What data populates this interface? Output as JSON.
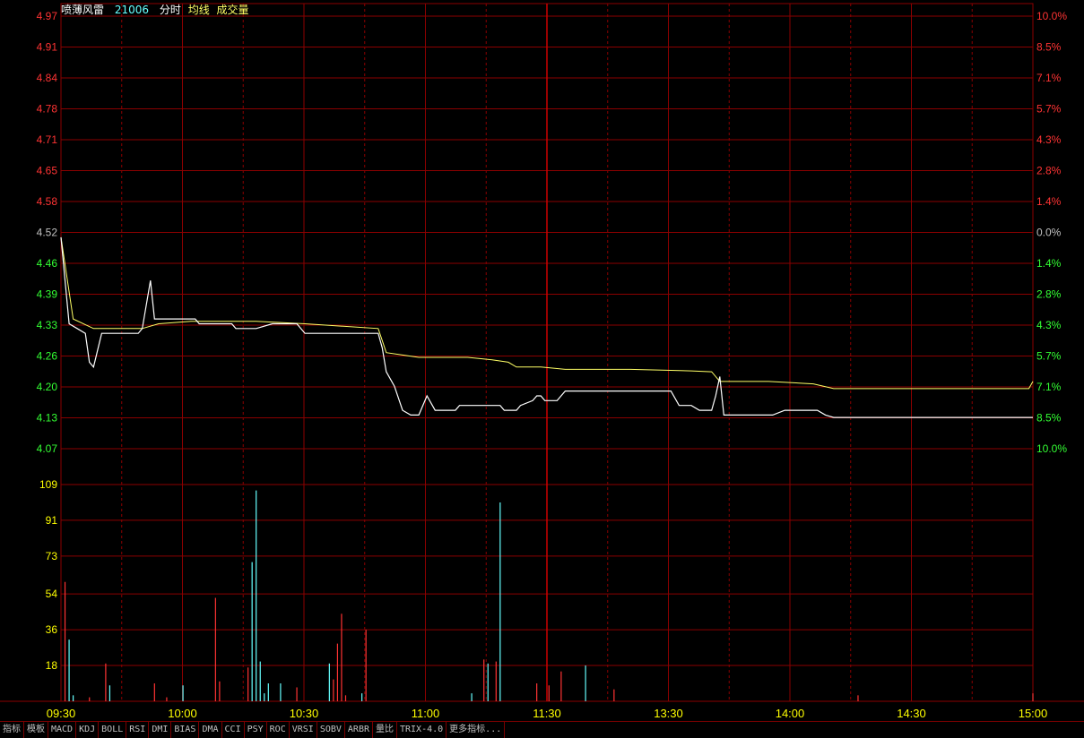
{
  "header": {
    "stock_name": "喷薄风雷",
    "stock_code": "21006",
    "label_intraday": "分时",
    "label_avg": "均线",
    "label_volume": "成交量"
  },
  "colors": {
    "background": "#000000",
    "grid": "#8b0000",
    "up": "#ff3333",
    "down": "#33ff33",
    "price_line": "#ffffff",
    "avg_line": "#ffff66",
    "volume_up": "#ff3333",
    "volume_down": "#66ffff",
    "volume_axis": "#ffff00",
    "time_axis": "#ffff00"
  },
  "chart_data": {
    "type": "line",
    "prev_close": 4.52,
    "price_ticks": [
      "4.97",
      "4.91",
      "4.84",
      "4.78",
      "4.71",
      "4.65",
      "4.58",
      "4.52",
      "4.46",
      "4.39",
      "4.33",
      "4.26",
      "4.20",
      "4.13",
      "4.07"
    ],
    "pct_ticks": [
      "10.0%",
      "8.5%",
      "7.1%",
      "5.7%",
      "4.3%",
      "2.8%",
      "1.4%",
      "0.0%",
      "1.4%",
      "2.8%",
      "4.3%",
      "5.7%",
      "7.1%",
      "8.5%",
      "10.0%"
    ],
    "ylim": [
      4.07,
      4.97
    ],
    "volume_ticks": [
      "109",
      "91",
      "73",
      "54",
      "36",
      "18"
    ],
    "volume_ylim": [
      0,
      127
    ],
    "time_labels": [
      "09:30",
      "10:00",
      "10:30",
      "11:00",
      "11:30",
      "13:30",
      "14:00",
      "14:30",
      "15:00"
    ],
    "price_series": [
      [
        0,
        4.51
      ],
      [
        2,
        4.33
      ],
      [
        4,
        4.32
      ],
      [
        6,
        4.31
      ],
      [
        7,
        4.25
      ],
      [
        8,
        4.24
      ],
      [
        10,
        4.31
      ],
      [
        14,
        4.31
      ],
      [
        19,
        4.31
      ],
      [
        20,
        4.32
      ],
      [
        22,
        4.42
      ],
      [
        23,
        4.34
      ],
      [
        33,
        4.34
      ],
      [
        34,
        4.33
      ],
      [
        42,
        4.33
      ],
      [
        43,
        4.32
      ],
      [
        48,
        4.32
      ],
      [
        52,
        4.33
      ],
      [
        58,
        4.33
      ],
      [
        60,
        4.31
      ],
      [
        64,
        4.31
      ],
      [
        70,
        4.31
      ],
      [
        72,
        4.31
      ],
      [
        78,
        4.31
      ],
      [
        79,
        4.28
      ],
      [
        80,
        4.23
      ],
      [
        82,
        4.2
      ],
      [
        84,
        4.15
      ],
      [
        86,
        4.14
      ],
      [
        88,
        4.14
      ],
      [
        90,
        4.18
      ],
      [
        92,
        4.15
      ],
      [
        97,
        4.15
      ],
      [
        98,
        4.16
      ],
      [
        108,
        4.16
      ],
      [
        109,
        4.15
      ],
      [
        112,
        4.15
      ],
      [
        113,
        4.16
      ],
      [
        116,
        4.17
      ],
      [
        117,
        4.18
      ],
      [
        118,
        4.18
      ],
      [
        119,
        4.17
      ],
      [
        122,
        4.17
      ],
      [
        124,
        4.19
      ],
      [
        150,
        4.19
      ],
      [
        152,
        4.16
      ],
      [
        155,
        4.16
      ],
      [
        157,
        4.15
      ],
      [
        160,
        4.15
      ],
      [
        161,
        4.18
      ],
      [
        162,
        4.22
      ],
      [
        163,
        4.14
      ],
      [
        168,
        4.14
      ],
      [
        175,
        4.14
      ],
      [
        178,
        4.15
      ],
      [
        186,
        4.15
      ],
      [
        188,
        4.14
      ],
      [
        190,
        4.135
      ],
      [
        239,
        4.135
      ]
    ],
    "avg_series": [
      [
        0,
        4.51
      ],
      [
        3,
        4.34
      ],
      [
        8,
        4.32
      ],
      [
        14,
        4.32
      ],
      [
        20,
        4.32
      ],
      [
        24,
        4.33
      ],
      [
        32,
        4.335
      ],
      [
        48,
        4.335
      ],
      [
        60,
        4.33
      ],
      [
        78,
        4.32
      ],
      [
        80,
        4.27
      ],
      [
        84,
        4.265
      ],
      [
        88,
        4.26
      ],
      [
        95,
        4.26
      ],
      [
        100,
        4.26
      ],
      [
        106,
        4.255
      ],
      [
        110,
        4.25
      ],
      [
        112,
        4.24
      ],
      [
        118,
        4.24
      ],
      [
        124,
        4.235
      ],
      [
        140,
        4.235
      ],
      [
        155,
        4.232
      ],
      [
        160,
        4.23
      ],
      [
        162,
        4.21
      ],
      [
        174,
        4.21
      ],
      [
        185,
        4.205
      ],
      [
        190,
        4.195
      ],
      [
        220,
        4.195
      ],
      [
        237,
        4.195
      ],
      [
        238,
        4.195
      ],
      [
        239,
        4.21
      ]
    ],
    "volume_bars": [
      [
        1,
        60,
        "up"
      ],
      [
        2,
        31,
        "down"
      ],
      [
        3,
        3,
        "down"
      ],
      [
        7,
        2,
        "up"
      ],
      [
        11,
        19,
        "up"
      ],
      [
        12,
        8,
        "down"
      ],
      [
        23,
        9,
        "up"
      ],
      [
        26,
        2,
        "up"
      ],
      [
        30,
        8,
        "down"
      ],
      [
        38,
        52,
        "up"
      ],
      [
        39,
        10,
        "up"
      ],
      [
        46,
        17,
        "up"
      ],
      [
        47,
        70,
        "down"
      ],
      [
        48,
        106,
        "down"
      ],
      [
        49,
        20,
        "down"
      ],
      [
        50,
        4,
        "down"
      ],
      [
        51,
        9,
        "down"
      ],
      [
        54,
        9,
        "down"
      ],
      [
        58,
        7,
        "up"
      ],
      [
        66,
        19,
        "down"
      ],
      [
        67,
        11,
        "up"
      ],
      [
        68,
        29,
        "up"
      ],
      [
        69,
        44,
        "up"
      ],
      [
        70,
        3,
        "up"
      ],
      [
        74,
        4,
        "down"
      ],
      [
        75,
        36,
        "up"
      ],
      [
        101,
        4,
        "down"
      ],
      [
        104,
        21,
        "up"
      ],
      [
        105,
        19,
        "down"
      ],
      [
        107,
        20,
        "up"
      ],
      [
        108,
        100,
        "down"
      ],
      [
        117,
        9,
        "up"
      ],
      [
        120,
        8,
        "up"
      ],
      [
        123,
        15,
        "up"
      ],
      [
        129,
        18,
        "down"
      ],
      [
        136,
        6,
        "up"
      ],
      [
        196,
        3,
        "up"
      ],
      [
        239,
        4,
        "up"
      ]
    ]
  },
  "tabs": [
    "指标",
    "模板",
    "MACD",
    "KDJ",
    "BOLL",
    "RSI",
    "DMI",
    "BIAS",
    "DMA",
    "CCI",
    "PSY",
    "ROC",
    "VRSI",
    "SOBV",
    "ARBR",
    "量比",
    "TRIX-4.0",
    "更多指标..."
  ]
}
